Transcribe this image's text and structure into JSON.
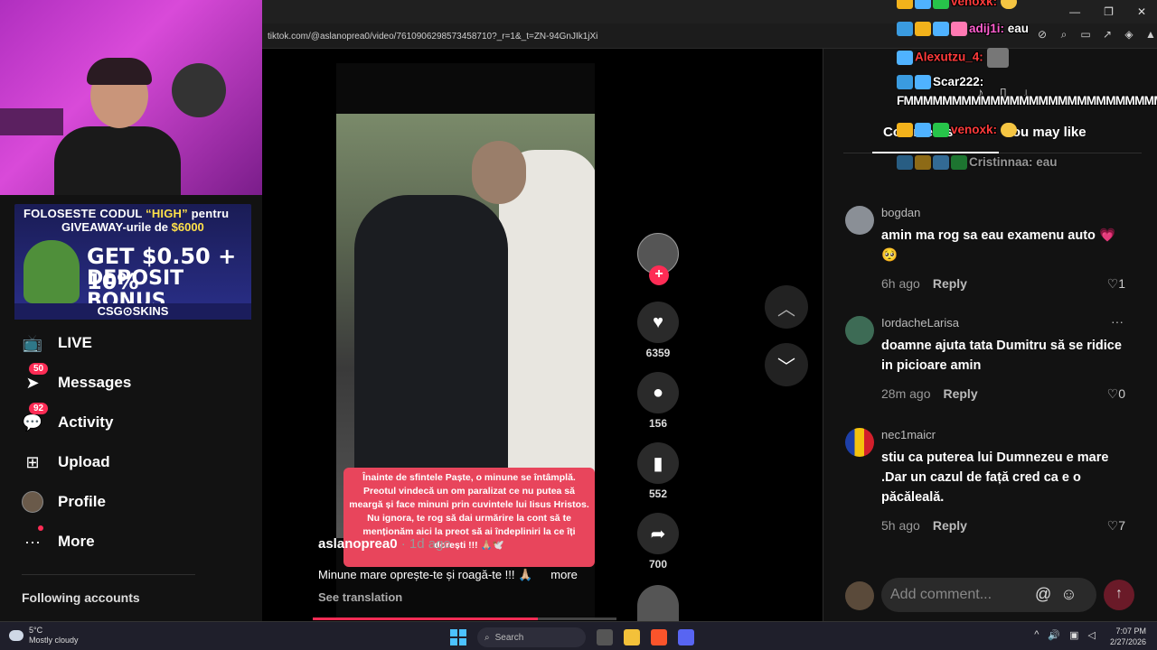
{
  "browser": {
    "url": "tiktok.com/@aslanoprea0/video/7610906298573458710?_r=1&_t=ZN-94GnJIk1jXi"
  },
  "ad": {
    "line1_pre": "FOLOSESTE CODUL ",
    "line1_code": "“HIGH”",
    "line1_post": " pentru",
    "line2_pre": "GIVEAWAY-urile de ",
    "line2_amount": "$6000",
    "big1": "GET $0.50 + 10%",
    "big2": "DEPOSIT BONUS",
    "footer": "CSG⊙SKINS"
  },
  "leftnav": {
    "items": [
      {
        "label": "LIVE",
        "icon": "live-tv-icon"
      },
      {
        "label": "Messages",
        "icon": "messages-icon",
        "badge": "50"
      },
      {
        "label": "Activity",
        "icon": "activity-icon",
        "badge": "92"
      },
      {
        "label": "Upload",
        "icon": "upload-icon"
      },
      {
        "label": "Profile",
        "icon": "avatar"
      },
      {
        "label": "More",
        "icon": "more-icon"
      }
    ],
    "following_header": "Following accounts"
  },
  "video": {
    "caption_overlay": "Înainte de sfintele Paște, o minune se întâmplă. Preotul vindecă un om paralizat ce nu putea să meargă și face minuni prin cuvintele lui Iisus Hristos. Nu ignora, te rog să dai urmărire la cont să te menționăm aici la preot să ai îndepliniri la ce îți dorești !!! 🙏🏼🕊️",
    "author": "aslanoprea0",
    "posted": " · 1d ago",
    "description": "Minune mare oprește-te și roagă-te !!! 🙏🏼",
    "more_label": "more",
    "see_translation": "See translation",
    "progress_fraction": 0.74,
    "stats": {
      "likes": "6359",
      "comments": "156",
      "saves": "552",
      "shares": "700"
    }
  },
  "comments_panel": {
    "tab_comments": "Comments",
    "tab_other": "You may like",
    "comments": [
      {
        "user": "bogdan",
        "text": "amin ma rog sa eau examenu auto 💗 🥺",
        "time": "6h ago",
        "reply": "Reply",
        "likes": "1"
      },
      {
        "user": "IordacheLarisa",
        "text": "doamne ajuta tata Dumitru să se ridice in picioare amin",
        "time": "28m ago",
        "reply": "Reply",
        "likes": "0"
      },
      {
        "user": "nec1maicr",
        "text": "stiu ca puterea lui Dumnezeu e mare .Dar un cazul de față cred ca e o păcăleală.",
        "time": "5h ago",
        "reply": "Reply",
        "likes": "7"
      }
    ],
    "add_comment_placeholder": "Add comment...",
    "more_options": "···"
  },
  "chat": {
    "lines": [
      {
        "user": "venoxk:",
        "msg": ""
      },
      {
        "user": "adij1i:",
        "msg": " eau"
      },
      {
        "user": "Alexutzu_4:",
        "msg": ""
      },
      {
        "user": "Scar222:",
        "msg": ""
      },
      {
        "user": "",
        "msg": "FMMMMMMMMMMMMMMMMMMMMMMMMMMM"
      },
      {
        "user": "venoxk:",
        "msg": ""
      },
      {
        "user": "Cristinnaa:",
        "msg": " eau"
      }
    ]
  },
  "taskbar": {
    "temp": "5°C",
    "weather": "Mostly cloudy",
    "search": "Search",
    "time": "7:07 PM",
    "date": "2/27/2026"
  },
  "colors": {
    "accent": "#fe2c55",
    "bg": "#121212"
  }
}
